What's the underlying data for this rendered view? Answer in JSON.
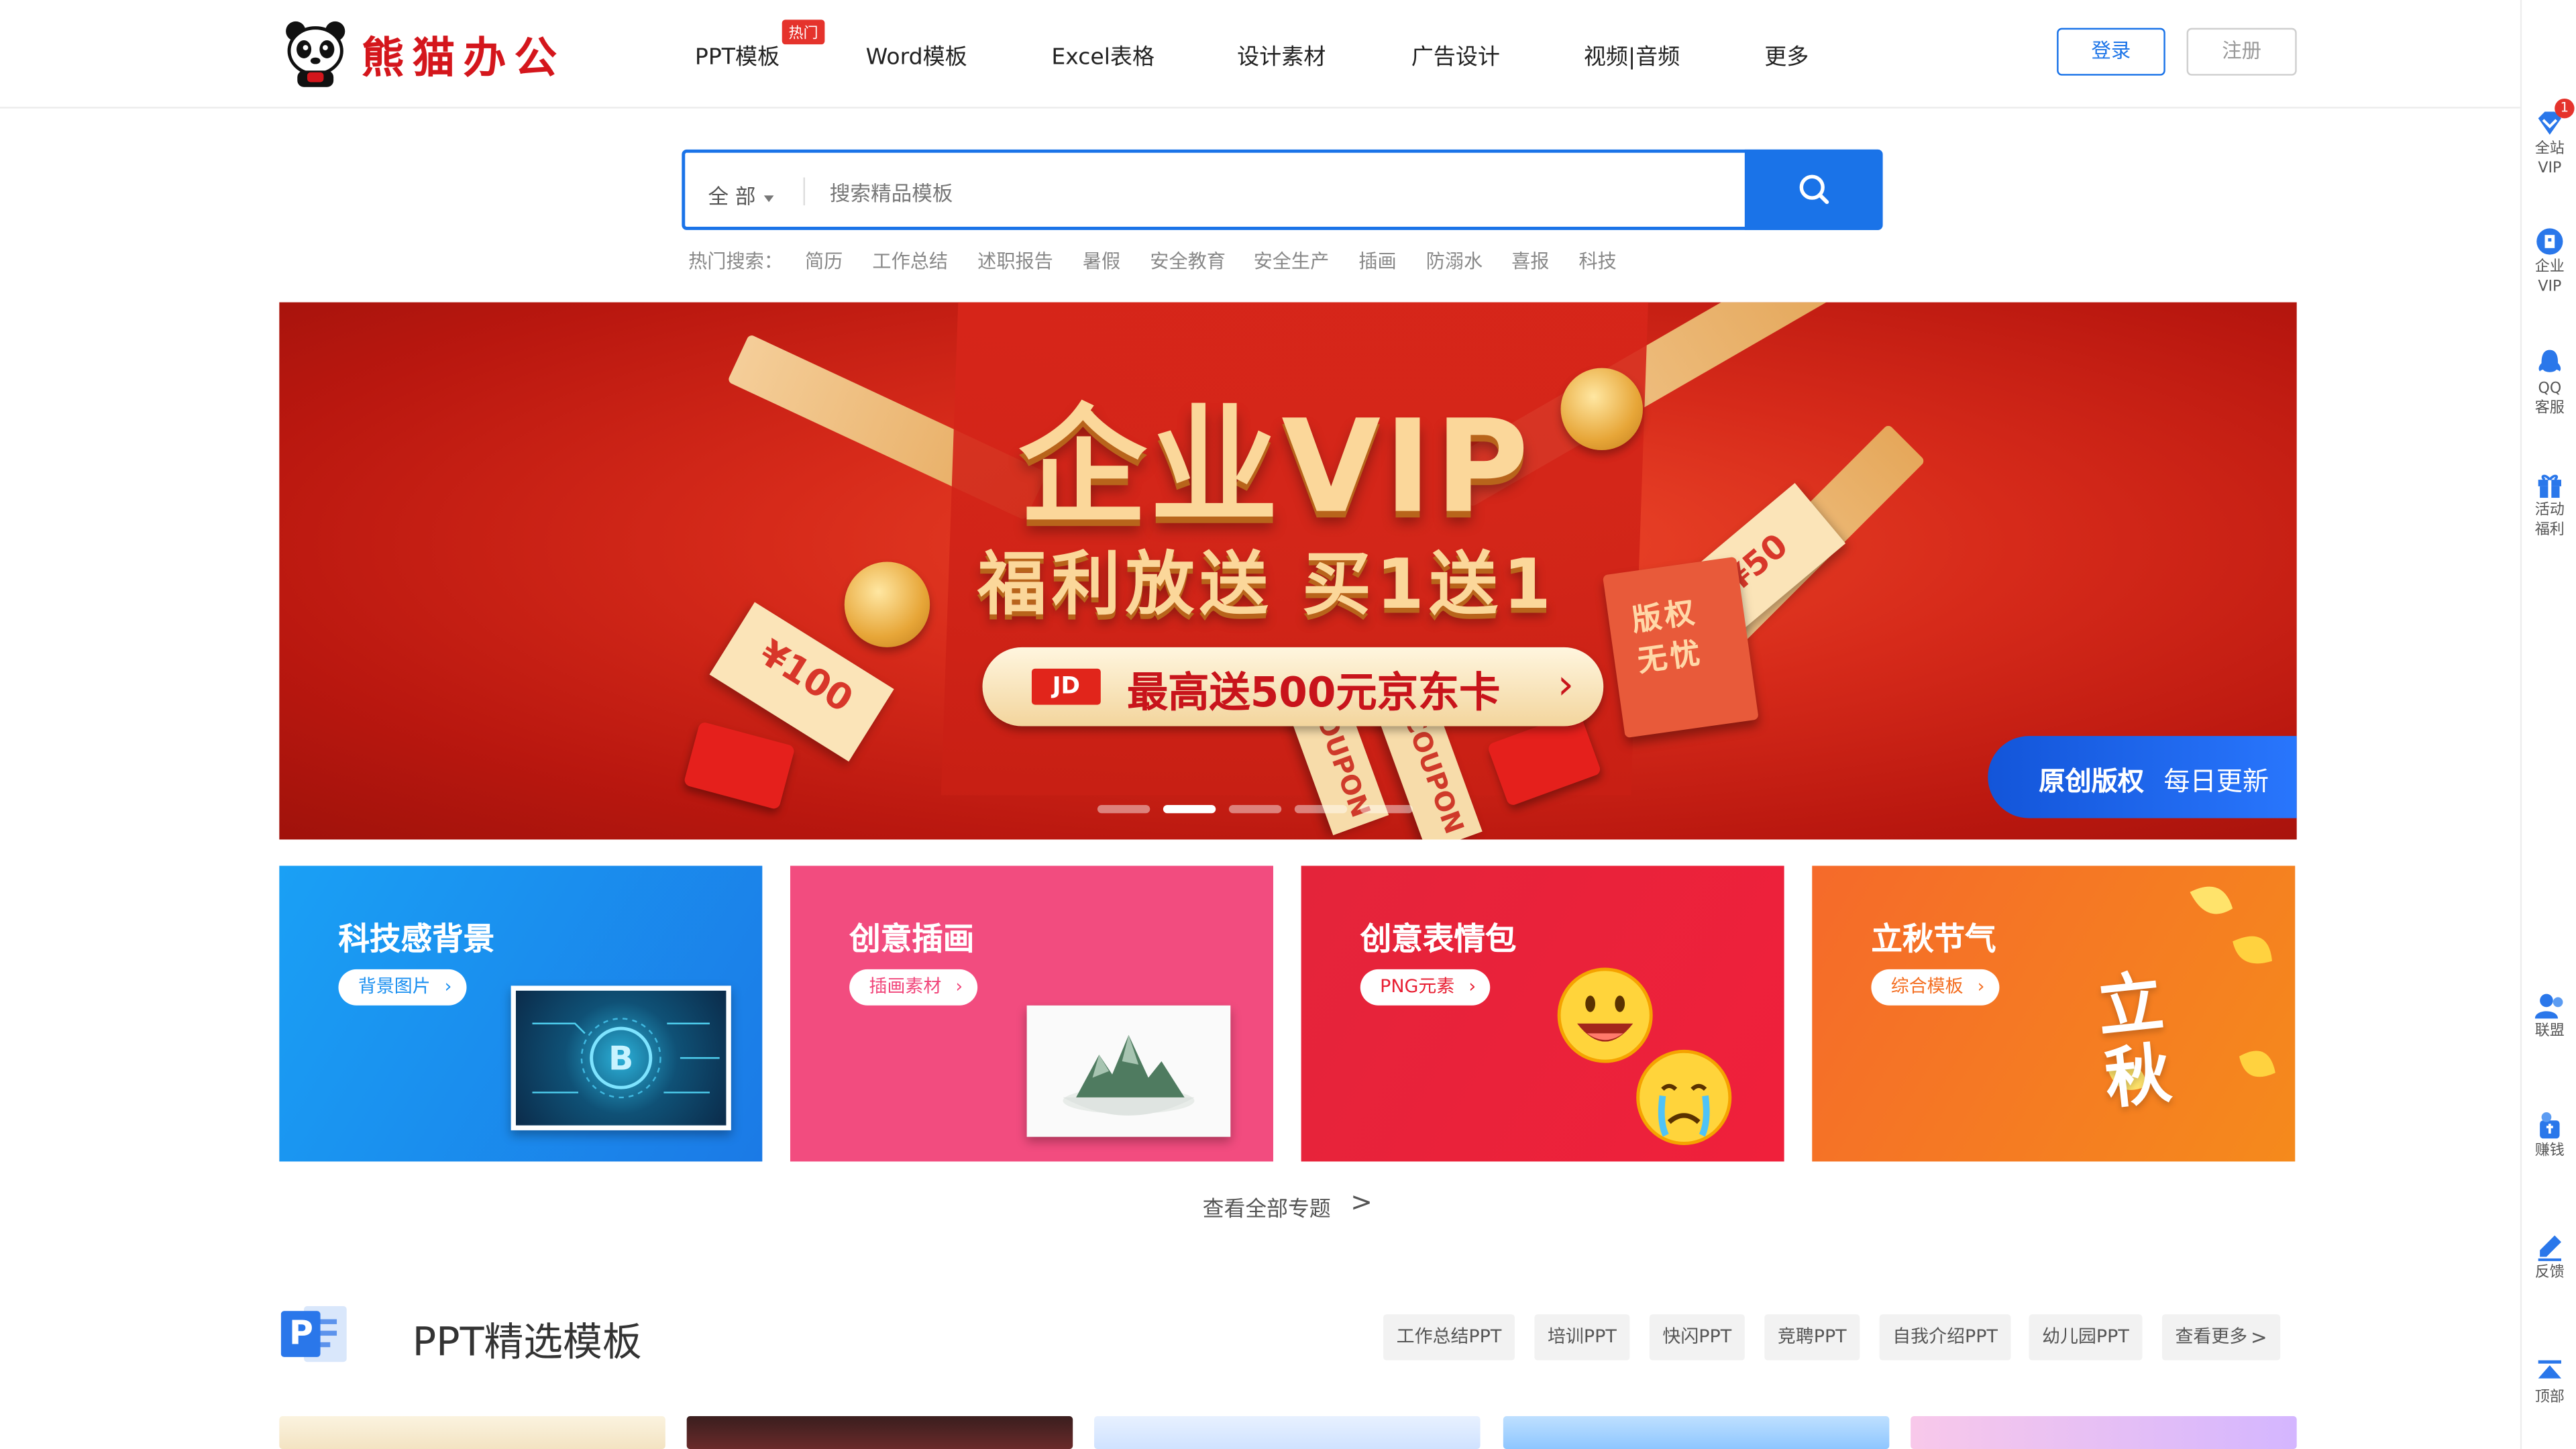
{
  "header": {
    "logo_text": "熊猫办公",
    "hot_badge": "热门",
    "nav": [
      {
        "label": "PPT模板"
      },
      {
        "label": "Word模板"
      },
      {
        "label": "Excel表格"
      },
      {
        "label": "设计素材"
      },
      {
        "label": "广告设计"
      },
      {
        "label": "视频|音频"
      },
      {
        "label": "更多"
      }
    ],
    "login": "登录",
    "register": "注册"
  },
  "search": {
    "scope": "全 部",
    "placeholder": "搜索精品模板",
    "hot_label": "热门搜索：",
    "hot_terms": [
      "简历",
      "工作总结",
      "述职报告",
      "暑假",
      "安全教育",
      "安全生产",
      "插画",
      "防溺水",
      "喜报",
      "科技"
    ]
  },
  "banner": {
    "title": "企业VIP",
    "subtitle": "福利放送 买1送1",
    "jd_logo": "JD",
    "cta": "最高送500元京东卡",
    "stamp_text": "版权无忧",
    "ticket_left": "¥100",
    "ticket_right": "¥50",
    "coupon_text": "COUPON",
    "tag_bold": "原创版权",
    "tag_light": "每日更新",
    "slides": 5,
    "active_slide": 2
  },
  "topics": [
    {
      "title": "科技感背景",
      "pill": "背景图片",
      "color": "#1a8ff0"
    },
    {
      "title": "创意插画",
      "pill": "插画素材",
      "color": "#f1467b"
    },
    {
      "title": "创意表情包",
      "pill": "PNG元素",
      "color": "#e81f33"
    },
    {
      "title": "立秋节气",
      "pill": "综合模板",
      "color": "#f46f22"
    }
  ],
  "topic_art": {
    "autumn_calligraphy": "立秋"
  },
  "view_all": "查看全部专题",
  "view_all_arrow": ">",
  "ppt_section": {
    "title": "PPT精选模板",
    "icon_letter": "P",
    "tags": [
      "工作总结PPT",
      "培训PPT",
      "快闪PPT",
      "竞聘PPT",
      "自我介绍PPT",
      "幼儿园PPT",
      "查看更多"
    ],
    "more_arrow": ">"
  },
  "rail": {
    "items": [
      {
        "label1": "全站",
        "label2": "VIP",
        "icon": "vip-diamond-icon"
      },
      {
        "label1": "企业",
        "label2": "VIP",
        "icon": "enterprise-icon"
      },
      {
        "label1": "QQ",
        "label2": "客服",
        "icon": "qq-icon"
      },
      {
        "label1": "活动",
        "label2": "福利",
        "icon": "gift-icon"
      },
      {
        "label1": "联盟",
        "label2": "",
        "icon": "alliance-icon"
      },
      {
        "label1": "赚钱",
        "label2": "",
        "icon": "earn-icon"
      },
      {
        "label1": "反馈",
        "label2": "",
        "icon": "feedback-icon"
      },
      {
        "label1": "顶部",
        "label2": "",
        "icon": "back-to-top-icon"
      }
    ],
    "badge": "1"
  },
  "colors": {
    "brand_blue": "#1a73e8",
    "brand_red": "#d4161c"
  }
}
